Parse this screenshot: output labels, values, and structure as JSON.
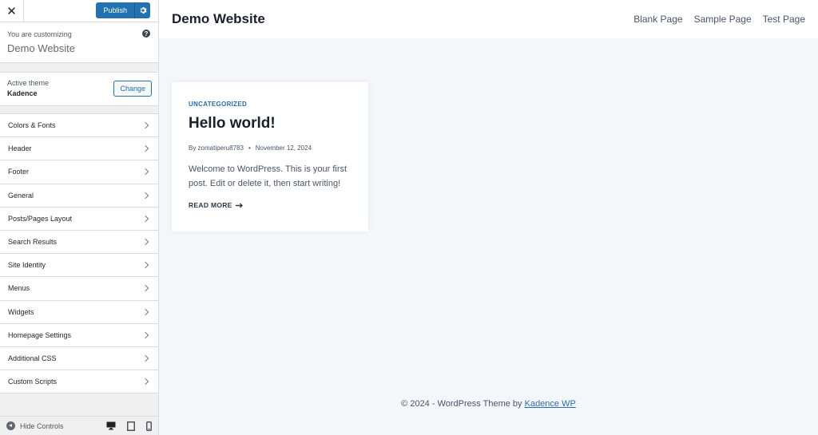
{
  "sidebar": {
    "close_label": "✕",
    "publish_label": "Publish",
    "customizing_label": "You are customizing",
    "site_name": "Demo Website",
    "active_theme_label": "Active theme",
    "theme_name": "Kadence",
    "change_label": "Change",
    "sections": [
      {
        "label": "Colors & Fonts"
      },
      {
        "label": "Header"
      },
      {
        "label": "Footer"
      },
      {
        "label": "General"
      },
      {
        "label": "Posts/Pages Layout"
      },
      {
        "label": "Search Results"
      },
      {
        "label": "Site Identity"
      },
      {
        "label": "Menus"
      },
      {
        "label": "Widgets"
      },
      {
        "label": "Homepage Settings"
      },
      {
        "label": "Additional CSS"
      },
      {
        "label": "Custom Scripts"
      }
    ],
    "hide_controls_label": "Hide Controls"
  },
  "preview": {
    "site_title": "Demo Website",
    "nav": [
      {
        "label": "Blank Page"
      },
      {
        "label": "Sample Page"
      },
      {
        "label": "Test Page"
      }
    ],
    "post": {
      "category": "UNCATEGORIZED",
      "title": "Hello world!",
      "author": "By zomatiperu8783",
      "date": "November 12, 2024",
      "excerpt": "Welcome to WordPress. This is your first post. Edit or delete it, then start writing!",
      "read_more": "READ MORE"
    },
    "footer_text": "© 2024 - WordPress Theme by ",
    "footer_link": "Kadence WP"
  },
  "colors": {
    "accent": "#2271b1",
    "link": "#2b6cb0"
  }
}
